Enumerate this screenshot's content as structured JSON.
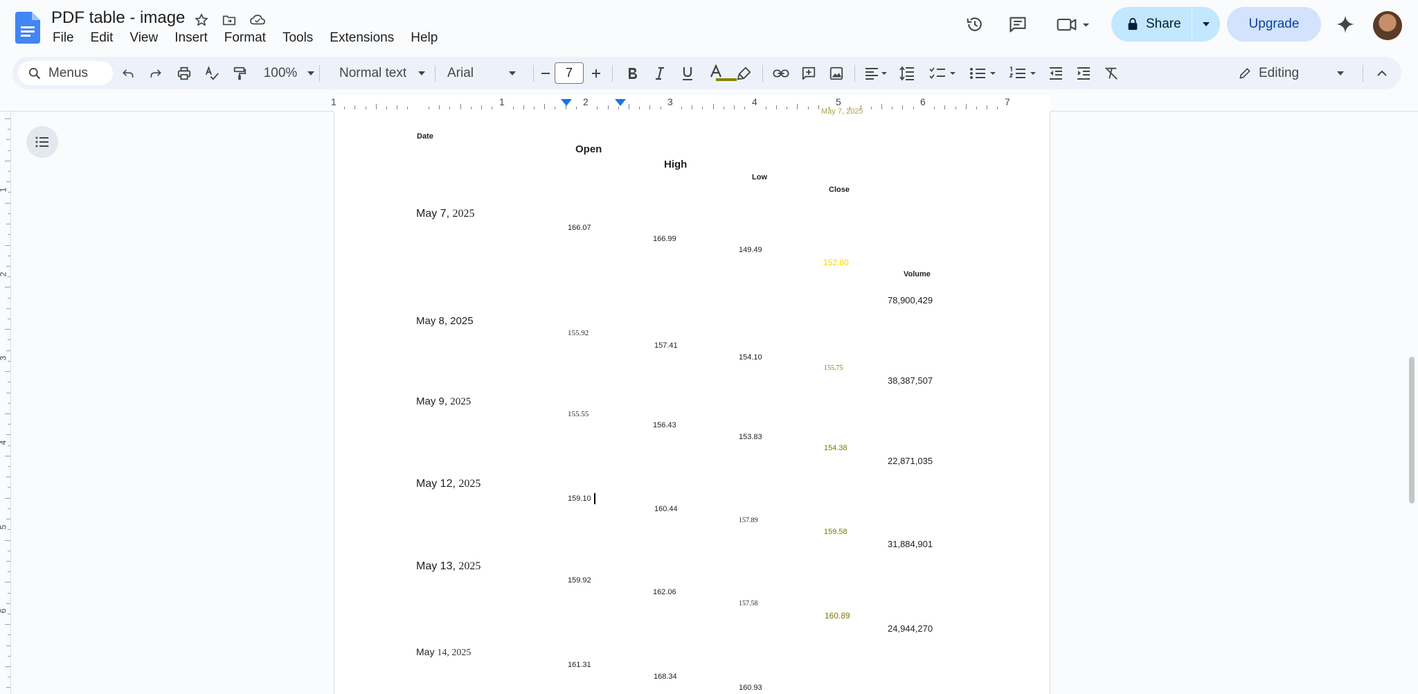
{
  "document": {
    "title": "PDF table - image"
  },
  "menu": [
    "File",
    "Edit",
    "View",
    "Insert",
    "Format",
    "Tools",
    "Extensions",
    "Help"
  ],
  "header_buttons": {
    "share_label": "Share",
    "upgrade_label": "Upgrade"
  },
  "toolbar": {
    "search_placeholder": "Menus",
    "zoom": "100%",
    "style": "Normal text",
    "font": "Arial",
    "font_size": "7",
    "mode": "Editing",
    "text_color": "#8a8000"
  },
  "ruler": {
    "labels": [
      "1",
      "1",
      "2",
      "3",
      "4",
      "5",
      "6",
      "7"
    ]
  },
  "vertical_ruler": {
    "labels": [
      "1",
      "2",
      "3",
      "4",
      "5",
      "6"
    ]
  },
  "table": {
    "headers": {
      "date": "Date",
      "open": "Open",
      "high": "High",
      "low": "Low",
      "close": "Close",
      "volume": "Volume"
    },
    "clipped_top_text": "May 7, 2025",
    "rows": [
      {
        "date_prefix": "May 7,",
        "date_year": "2025",
        "open": "166.07",
        "high": "166.99",
        "low": "149.49",
        "close": "152.80",
        "volume": "78,900,429"
      },
      {
        "date_prefix": "May 8, 2025",
        "date_year": "",
        "open": "155.92",
        "high": "157.41",
        "low": "154.10",
        "close": "155.75",
        "volume": "38,387,507"
      },
      {
        "date_prefix": "May 9,",
        "date_year": "2025",
        "open": "155.55",
        "high": "156.43",
        "low": "153.83",
        "close": "154.38",
        "volume": "22,871,035"
      },
      {
        "date_prefix": "May 12,",
        "date_year": "2025",
        "open": "159.10",
        "high": "160.44",
        "low": "157.89",
        "close": "159.58",
        "volume": "31,884,901"
      },
      {
        "date_prefix": "May 13,",
        "date_year": "2025",
        "open": "159.92",
        "high": "162.06",
        "low": "157.58",
        "close": "160.89",
        "volume": "24,944,270"
      },
      {
        "date_prefix": "May",
        "date_year": "14, 2025",
        "open": "161.31",
        "high": "168.34",
        "low": "160.93",
        "close": "",
        "volume": ""
      }
    ]
  },
  "colors": {
    "accent": "#1a73e8",
    "share_bg": "#c2e7ff",
    "upgrade_bg": "#d3e3fd",
    "close_yellow": "#ffd400",
    "close_olive": "#7a7a00"
  }
}
